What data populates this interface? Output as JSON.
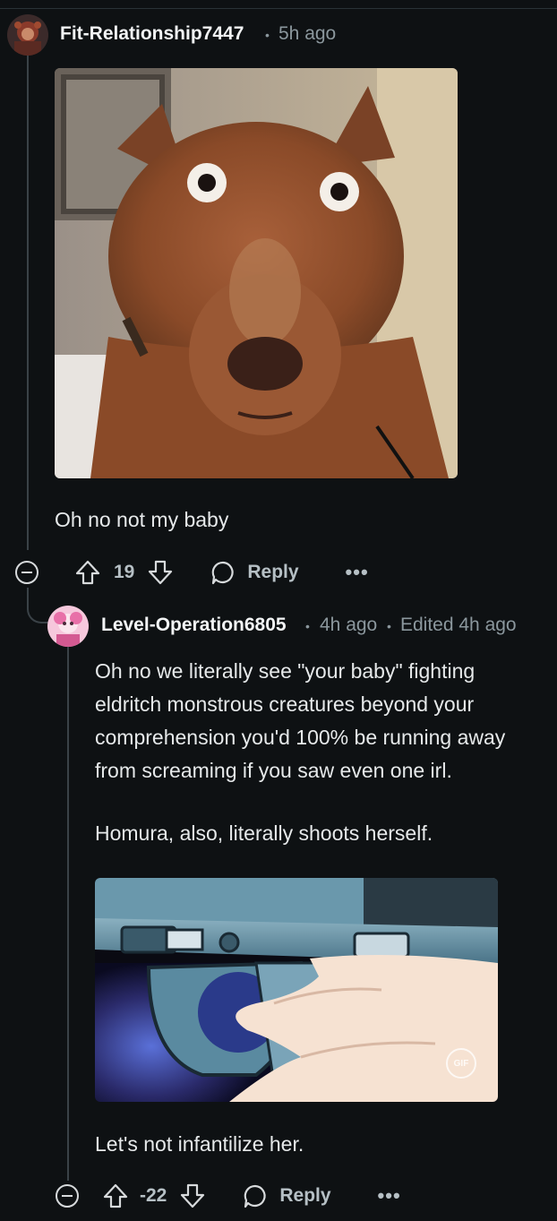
{
  "comment1": {
    "username": "Fit-Relationship7447",
    "time": "5h ago",
    "image_alt": "Wide-eyed brown dog meme",
    "body": "Oh no not my baby",
    "votes": "19",
    "reply_label": "Reply",
    "more": "•••"
  },
  "comment2": {
    "username": "Level-Operation6805",
    "time": "4h ago",
    "edited": "Edited 4h ago",
    "paragraph1_lines": [
      "Oh no we literally see \"your baby\" fighting",
      "eldritch monstrous creatures beyond your",
      "comprehension you'd 100% be running away",
      "from screaming if you saw even one irl."
    ],
    "paragraph2": "Homura, also, literally shoots herself.",
    "gif_badge": "GIF",
    "paragraph3": "Let's not infantilize her.",
    "votes": "-22",
    "reply_label": "Reply",
    "more": "•••"
  },
  "separator": "•",
  "colors": {
    "background": "#0e1113",
    "text": "#d7dadc",
    "meta": "#8b979d",
    "thread_line": "#3a4247"
  }
}
